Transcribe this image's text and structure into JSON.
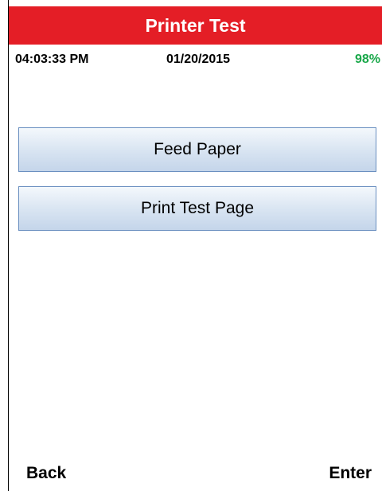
{
  "header": {
    "title": "Printer Test"
  },
  "status": {
    "time": "04:03:33 PM",
    "date": "01/20/2015",
    "battery": "98%"
  },
  "menu": {
    "items": [
      {
        "label": "Feed Paper"
      },
      {
        "label": "Print Test Page"
      }
    ]
  },
  "softkeys": {
    "back": "Back",
    "enter": "Enter"
  },
  "colors": {
    "title_bar": "#e41e26",
    "battery_text": "#1aa84a",
    "button_border": "#6a8fc0"
  }
}
